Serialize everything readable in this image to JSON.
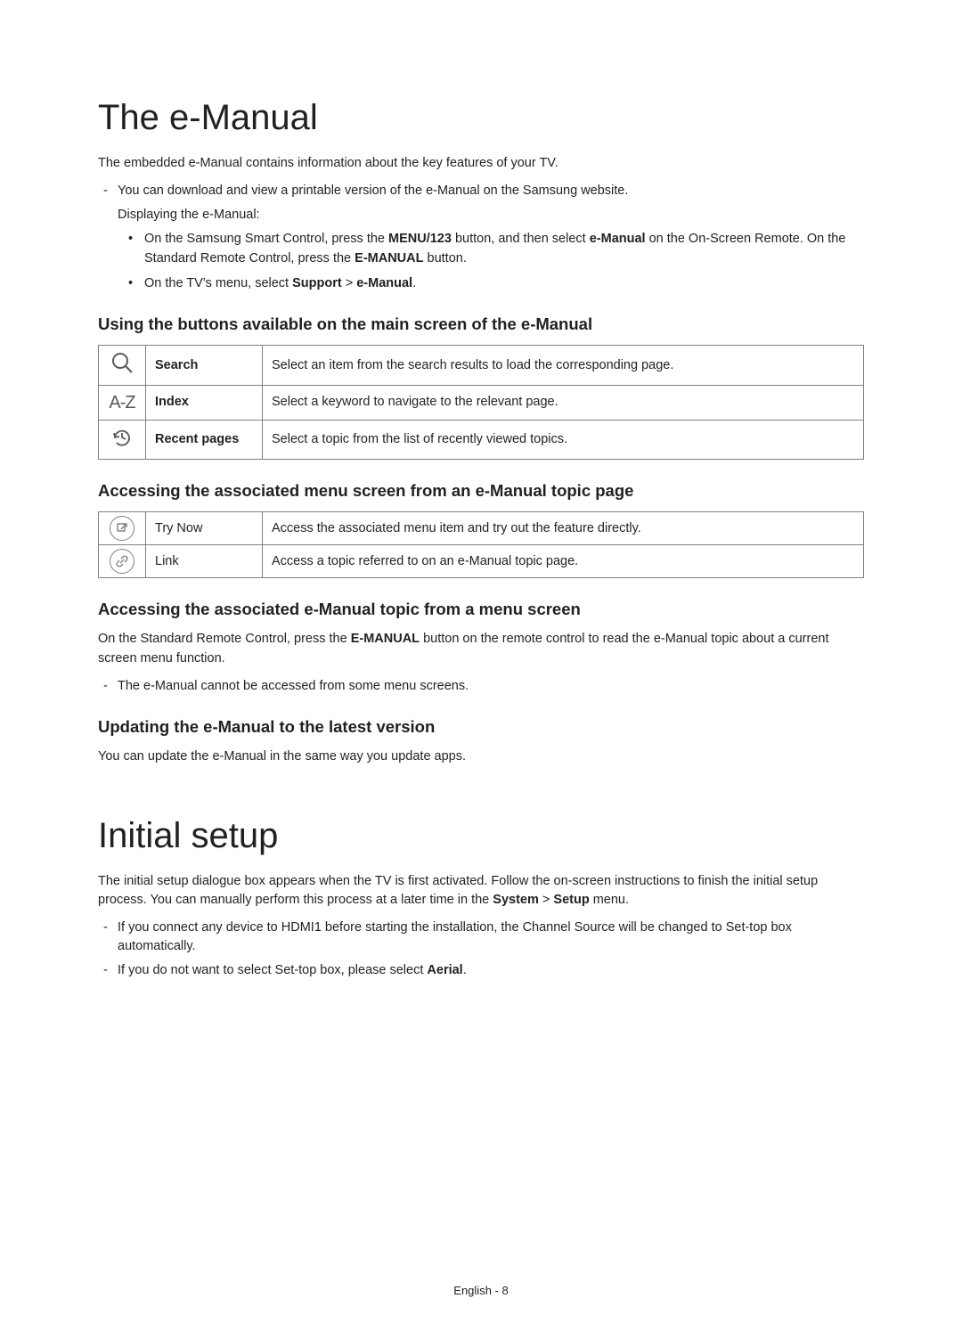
{
  "section1": {
    "title": "The e-Manual",
    "intro": "The embedded e-Manual contains information about the key features of your TV.",
    "download_line": "You can download and view a printable version of the e-Manual on the Samsung website.",
    "displaying_label": "Displaying the e-Manual:",
    "bullet1_pre": "On the Samsung Smart Control, press the ",
    "bullet1_bold1": "MENU/123",
    "bullet1_mid": " button, and then select ",
    "bullet1_bold2": "e-Manual",
    "bullet1_post": " on the On-Screen Remote. On the Standard Remote Control, press the ",
    "bullet1_bold3": "E-MANUAL",
    "bullet1_end": " button.",
    "bullet2_pre": "On the TV's menu, select ",
    "bullet2_bold1": "Support",
    "bullet2_sep": " > ",
    "bullet2_bold2": "e-Manual",
    "bullet2_end": "."
  },
  "section2": {
    "heading": "Using the buttons available on the main screen of the e-Manual",
    "rows": [
      {
        "label": "Search",
        "desc": "Select an item from the search results to load the corresponding page."
      },
      {
        "label": "Index",
        "desc": "Select a keyword to navigate to the relevant page."
      },
      {
        "label": "Recent pages",
        "desc": "Select a topic from the list of recently viewed topics."
      }
    ]
  },
  "section3": {
    "heading": "Accessing the associated menu screen from an e-Manual topic page",
    "rows": [
      {
        "label": "Try Now",
        "desc": "Access the associated menu item and try out the feature directly."
      },
      {
        "label": "Link",
        "desc": "Access a topic referred to on an e-Manual topic page."
      }
    ]
  },
  "section4": {
    "heading": "Accessing the associated e-Manual topic from a menu screen",
    "para_pre": "On the Standard Remote Control, press the ",
    "para_bold": "E-MANUAL",
    "para_post": " button on the remote control to read the e-Manual topic about a current screen menu function.",
    "note": "The e-Manual cannot be accessed from some menu screens."
  },
  "section5": {
    "heading": "Updating the e-Manual to the latest version",
    "para": "You can update the e-Manual in the same way you update apps."
  },
  "initial": {
    "title": "Initial setup",
    "para_pre": "The initial setup dialogue box appears when the TV is first activated. Follow the on-screen instructions to finish the initial setup process. You can manually perform this process at a later time in the ",
    "para_bold1": "System",
    "para_sep": " > ",
    "para_bold2": "Setup",
    "para_post": " menu.",
    "note1": "If you connect any device to HDMI1 before starting the installation, the Channel Source will be changed to Set-top box automatically.",
    "note2_pre": "If you do not want to select Set-top box, please select ",
    "note2_bold": "Aerial",
    "note2_post": "."
  },
  "footer": {
    "text": "English - 8"
  }
}
